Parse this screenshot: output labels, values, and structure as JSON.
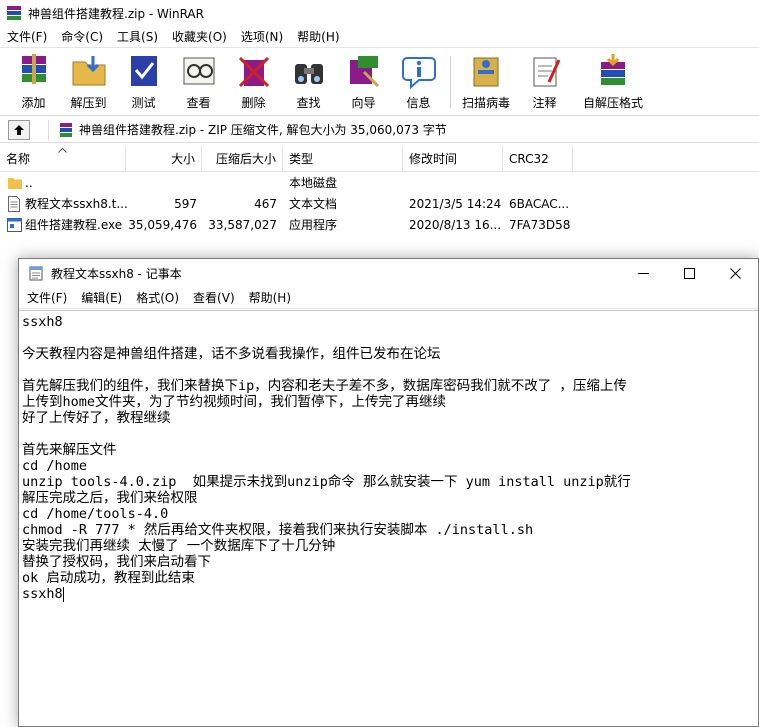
{
  "winrar": {
    "title": "神兽组件搭建教程.zip - WinRAR",
    "menu": [
      "文件(F)",
      "命令(C)",
      "工具(S)",
      "收藏夹(O)",
      "选项(N)",
      "帮助(H)"
    ],
    "toolbar": [
      {
        "label": "添加",
        "icon": "add-archive-icon"
      },
      {
        "label": "解压到",
        "icon": "extract-to-icon"
      },
      {
        "label": "测试",
        "icon": "test-icon"
      },
      {
        "label": "查看",
        "icon": "view-icon"
      },
      {
        "label": "删除",
        "icon": "delete-icon"
      },
      {
        "label": "查找",
        "icon": "find-icon"
      },
      {
        "label": "向导",
        "icon": "wizard-icon"
      },
      {
        "label": "信息",
        "icon": "info-icon"
      },
      {
        "label": "扫描病毒",
        "icon": "virus-scan-icon"
      },
      {
        "label": "注释",
        "icon": "comment-icon"
      },
      {
        "label": "自解压格式",
        "icon": "sfx-icon"
      }
    ],
    "path_text": "神兽组件搭建教程.zip - ZIP 压缩文件, 解包大小为 35,060,073 字节",
    "columns": {
      "name": "名称",
      "size": "大小",
      "packed": "压缩后大小",
      "type": "类型",
      "modified": "修改时间",
      "crc": "CRC32"
    },
    "files": [
      {
        "name": "..",
        "size": "",
        "packed": "",
        "type": "本地磁盘",
        "modified": "",
        "crc": ""
      },
      {
        "name": "教程文本ssxh8.t...",
        "size": "597",
        "packed": "467",
        "type": "文本文档",
        "modified": "2021/3/5 14:24",
        "crc": "6BACAC..."
      },
      {
        "name": "组件搭建教程.exe",
        "size": "35,059,476",
        "packed": "33,587,027",
        "type": "应用程序",
        "modified": "2020/8/13 16...",
        "crc": "7FA73D58"
      }
    ]
  },
  "notepad": {
    "title": "教程文本ssxh8 - 记事本",
    "menu": [
      "文件(F)",
      "编辑(E)",
      "格式(O)",
      "查看(V)",
      "帮助(H)"
    ],
    "lines": [
      "ssxh8",
      "",
      "今天教程内容是神兽组件搭建，话不多说看我操作，组件已发布在论坛",
      "",
      "首先解压我们的组件，我们来替换下ip，内容和老夫子差不多，数据库密码我们就不改了 ，压缩上传",
      "上传到home文件夹，为了节约视频时间，我们暂停下，上传完了再继续",
      "好了上传好了，教程继续",
      "",
      "首先来解压文件",
      "cd /home",
      "unzip tools-4.0.zip  如果提示未找到unzip命令 那么就安装一下 yum install unzip就行",
      "解压完成之后，我们来给权限",
      "cd /home/tools-4.0",
      "chmod -R 777 * 然后再给文件夹权限，接着我们来执行安装脚本 ./install.sh",
      "安装完我们再继续 太慢了 一个数据库下了十几分钟",
      "替换了授权码，我们来启动看下",
      "ok 启动成功，教程到此结束",
      "ssxh8"
    ]
  }
}
